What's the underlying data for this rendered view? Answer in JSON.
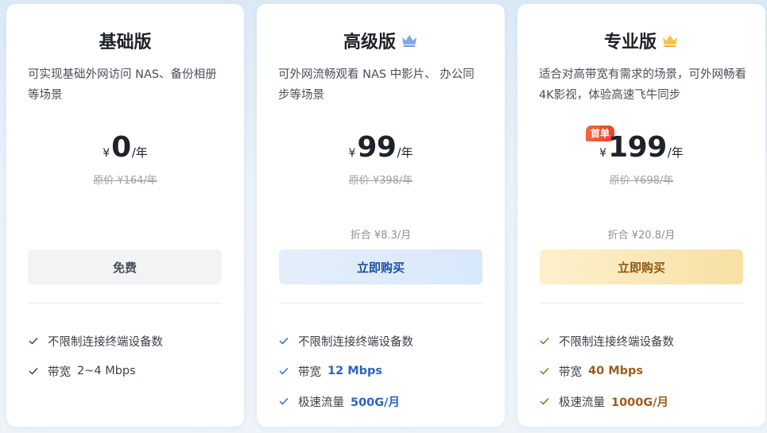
{
  "colors": {
    "adv_accent": "#2d64c4",
    "pro_accent": "#9a5f1c",
    "badge": "#e9432e"
  },
  "plans": [
    {
      "name": "基础版",
      "description": "可实现基础外网访问 NAS、备份相册等场景",
      "currency": "¥",
      "price": "0",
      "unit": "/年",
      "original": "原价 ¥164/年",
      "button": "免费",
      "features": [
        {
          "label": "不限制连接终端设备数"
        },
        {
          "label": "带宽",
          "value": "2~4 Mbps"
        }
      ]
    },
    {
      "name": "高级版",
      "icon": "crown-icon-blue",
      "description": "可外网流畅观看 NAS 中影片、 办公同步等场景",
      "currency": "¥",
      "price": "99",
      "unit": "/年",
      "original": "原价 ¥398/年",
      "monthly": "折合 ¥8.3/月",
      "button": "立即购买",
      "features": [
        {
          "label": "不限制连接终端设备数"
        },
        {
          "label": "带宽",
          "value": "12 Mbps"
        },
        {
          "label": "极速流量",
          "value": "500G/月"
        }
      ]
    },
    {
      "name": "专业版",
      "icon": "crown-icon-gold",
      "badge": "首单",
      "description": "适合对高带宽有需求的场景，可外网畅看4K影视，体验高速飞牛同步",
      "currency": "¥",
      "price": "199",
      "unit": "/年",
      "original": "原价 ¥698/年",
      "monthly": "折合 ¥20.8/月",
      "button": "立即购买",
      "features": [
        {
          "label": "不限制连接终端设备数"
        },
        {
          "label": "带宽",
          "value": "40 Mbps"
        },
        {
          "label": "极速流量",
          "value": "1000G/月"
        }
      ]
    }
  ]
}
